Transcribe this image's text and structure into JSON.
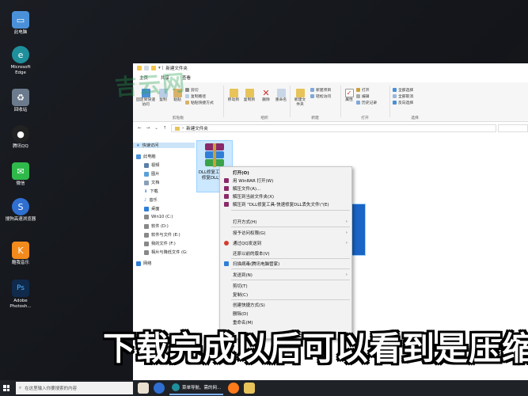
{
  "desktop": {
    "icons": [
      {
        "label": "此电脑",
        "color": "#4a90d9"
      },
      {
        "label": "Microsoft Edge",
        "color": "#1f8f9c"
      },
      {
        "label": "回收站",
        "color": "#6b7a8c"
      },
      {
        "label": "腾讯QQ",
        "color": "#222222"
      },
      {
        "label": "微信",
        "color": "#2fb94a"
      },
      {
        "label": "搜狗高速浏览器",
        "color": "#2f6fd1"
      },
      {
        "label": "酷我音乐",
        "color": "#f28a1c"
      },
      {
        "label": "Adobe Photosh...",
        "color": "#0f2a4b"
      }
    ]
  },
  "explorer": {
    "title": "新建文件夹",
    "tabs": [
      "文件",
      "主页",
      "共享",
      "查看"
    ],
    "ribbon": {
      "clipboard": {
        "caption": "剪贴板",
        "pin": "固定到快速访问",
        "copy": "复制",
        "paste": "粘贴",
        "cut": "剪切",
        "copy_path": "复制路径",
        "paste_shortcut": "粘贴快捷方式"
      },
      "organize": {
        "caption": "组织",
        "move_to": "移动到",
        "copy_to": "复制到",
        "delete": "删除",
        "rename": "重命名"
      },
      "new": {
        "caption": "新建",
        "new_folder": "新建文件夹",
        "new_item": "新建项目",
        "easy_access": "轻松访问"
      },
      "open": {
        "caption": "打开",
        "properties": "属性",
        "open": "打开",
        "edit": "编辑",
        "history": "历史记录"
      },
      "select": {
        "caption": "选择",
        "select_all": "全部选择",
        "select_none": "全部取消",
        "invert": "反向选择"
      }
    },
    "address": {
      "path": "新建文件夹"
    },
    "nav": [
      "快速访问",
      "此电脑",
      "视频",
      "图片",
      "文档",
      "下载",
      "音乐",
      "桌面",
      "Win10 (C:)",
      "软件 (D:)",
      "软件与文件 (E:)",
      "我的文件 (F:)",
      "相片与降低文件 (G:",
      "网络"
    ],
    "file": {
      "name": "DLL修复工具_速修复DLL文件"
    }
  },
  "context_menu": {
    "items": [
      {
        "label": "打开(O)",
        "icon_color": "",
        "bold": true,
        "arrow": false
      },
      {
        "label": "用 WinRAR 打开(W)",
        "icon_color": "#8a2a6a",
        "arrow": false
      },
      {
        "label": "解压文件(A)...",
        "icon_color": "#8a2a6a",
        "arrow": false
      },
      {
        "label": "解压到当前文件夹(X)",
        "icon_color": "#8a2a6a",
        "arrow": false
      },
      {
        "label": "解压到 \"DLL修复工具-快速修复DLL丢失文件\\\"(E)",
        "icon_color": "#8a2a6a",
        "arrow": false
      },
      {
        "label": "打开方式(H)",
        "icon_color": "",
        "arrow": true
      },
      {
        "label": "授予访问权限(G)",
        "icon_color": "",
        "arrow": true
      },
      {
        "label": "通过QQ发送到",
        "icon_color": "#d63b2e",
        "arrow": true
      },
      {
        "label": "还原以前的版本(V)",
        "icon_color": "",
        "arrow": false
      },
      {
        "label": "扫描病毒(腾讯电脑管家)",
        "icon_color": "#2f7fd8",
        "arrow": false
      },
      {
        "label": "发送到(N)",
        "icon_color": "",
        "arrow": true
      },
      {
        "label": "剪切(T)",
        "icon_color": "",
        "arrow": false
      },
      {
        "label": "复制(C)",
        "icon_color": "",
        "arrow": false
      },
      {
        "label": "创建快捷方式(S)",
        "icon_color": "",
        "arrow": false
      },
      {
        "label": "删除(D)",
        "icon_color": "",
        "arrow": false
      },
      {
        "label": "重命名(M)",
        "icon_color": "",
        "arrow": false
      }
    ]
  },
  "overlay": {
    "subtitle": "下载完成以后可以看到是压缩",
    "watermark": "吉云网"
  },
  "taskbar": {
    "search_placeholder": "在这里输入你要搜索的内容",
    "app_label": "菜单导航、需的网..."
  }
}
